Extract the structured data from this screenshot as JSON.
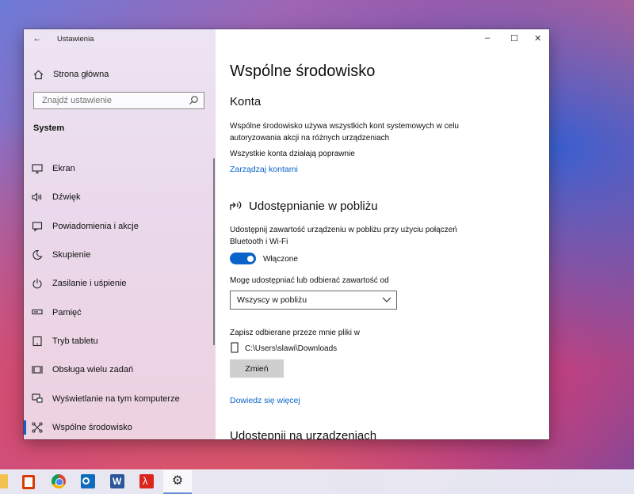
{
  "window": {
    "app_title": "Ustawienia",
    "controls": {
      "minimize": "–",
      "maximize": "☐",
      "close": "✕"
    }
  },
  "sidebar": {
    "home_label": "Strona główna",
    "search_placeholder": "Znajdź ustawienie",
    "section_title": "System",
    "items": [
      {
        "label": "Ekran",
        "icon": "monitor-icon"
      },
      {
        "label": "Dźwięk",
        "icon": "speaker-icon"
      },
      {
        "label": "Powiadomienia i akcje",
        "icon": "notification-icon"
      },
      {
        "label": "Skupienie",
        "icon": "moon-icon"
      },
      {
        "label": "Zasilanie i uśpienie",
        "icon": "power-icon"
      },
      {
        "label": "Pamięć",
        "icon": "storage-icon"
      },
      {
        "label": "Tryb tabletu",
        "icon": "tablet-icon"
      },
      {
        "label": "Obsługa wielu zadań",
        "icon": "multitasking-icon"
      },
      {
        "label": "Wyświetlanie na tym komputerze",
        "icon": "project-icon"
      },
      {
        "label": "Wspólne środowisko",
        "icon": "shared-experiences-icon",
        "active": true
      }
    ]
  },
  "content": {
    "page_title": "Wspólne środowisko",
    "accounts": {
      "heading": "Konta",
      "description": "Wspólne środowisko używa wszystkich kont systemowych w celu autoryzowania akcji na różnych urządzeniach",
      "status": "Wszystkie konta działają poprawnie",
      "manage_link": "Zarządzaj kontami"
    },
    "nearby": {
      "heading": "Udostępnianie w pobliżu",
      "description": "Udostępnij zawartość urządzeniu w pobliżu przy użyciu połączeń Bluetooth i Wi-Fi",
      "toggle_label": "Włączone",
      "toggle_on": true,
      "receive_label": "Mogę udostępniać lub odbierać zawartość od",
      "receive_value": "Wszyscy w pobliżu",
      "save_label": "Zapisz odbierane przeze mnie pliki w",
      "save_path": "C:\\Users\\slawi\\Downloads",
      "change_button": "Zmień",
      "learn_more": "Dowiedz się więcej"
    },
    "next_heading": "Udostępnij na urządzeniach"
  },
  "taskbar": {
    "apps": [
      "file-explorer-icon",
      "office-icon",
      "chrome-icon",
      "outlook-icon",
      "word-icon",
      "acrobat-icon",
      "settings-icon"
    ]
  },
  "colors": {
    "accent": "#0a63c9"
  }
}
